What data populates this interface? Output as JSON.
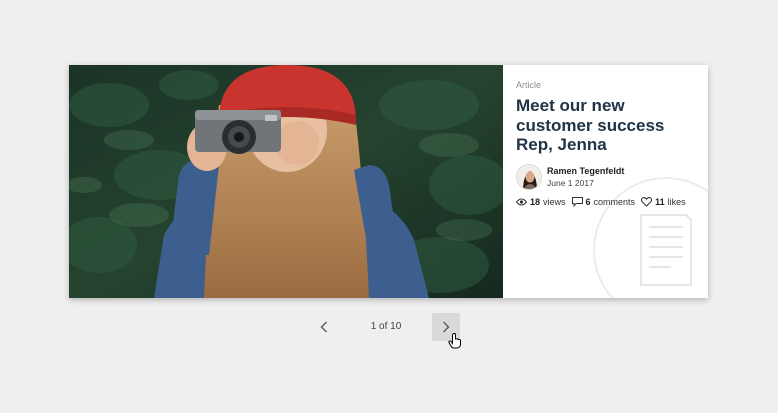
{
  "article": {
    "category": "Article",
    "title": "Meet our new customer success Rep, Jenna",
    "author": {
      "name": "Ramen Tegenfeldt",
      "date": "June 1 2017"
    },
    "stats": {
      "views_count": "18",
      "views_label": "views",
      "comments_count": "6",
      "comments_label": "comments",
      "likes_count": "11",
      "likes_label": "likes"
    }
  },
  "pagination": {
    "indicator": "1 of 10"
  },
  "icons": {
    "views": "eye-icon",
    "comments": "comment-icon",
    "likes": "heart-icon",
    "prev": "chevron-left-icon",
    "next": "chevron-right-icon",
    "watermark": "document-icon",
    "cursor": "hand-pointer-icon"
  },
  "colors": {
    "background": "#efefef",
    "card": "#ffffff",
    "title": "#213446",
    "next_button": "#d9d9d9",
    "hat": "#c9352e",
    "jacket": "#3d5f8f",
    "foliage": "#1f3b2c"
  }
}
